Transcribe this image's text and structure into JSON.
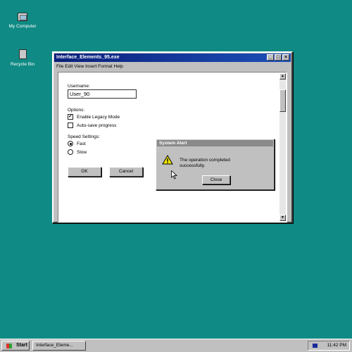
{
  "desktop": {
    "icons": [
      {
        "label": "My Computer",
        "icon": "computer-icon"
      },
      {
        "label": "Recycle Bin",
        "icon": "recycle-bin-icon"
      }
    ],
    "background_color": "#0f8a84"
  },
  "window": {
    "title": "Interface_Elements_95.exe",
    "controls": {
      "minimize": "_",
      "maximize": "□",
      "close": "×"
    },
    "menu": "File Edit View Insert Format Help",
    "form": {
      "username_label": "Username:",
      "username_value": "User_90",
      "options_label": "Options:",
      "options": [
        {
          "label": "Enable Legacy Mode",
          "checked": true,
          "mark": "✓"
        },
        {
          "label": "Auto-save progress",
          "checked": false,
          "mark": ""
        }
      ],
      "speed_label": "Speed Settings:",
      "speeds": [
        {
          "label": "Fast",
          "selected": true
        },
        {
          "label": "Slow",
          "selected": false
        }
      ],
      "ok_label": "OK",
      "cancel_label": "Cancel"
    },
    "scroll": {
      "up": "▲",
      "down": "▼"
    }
  },
  "alert": {
    "title": "System Alert",
    "icon": "warning-icon",
    "message": "The operation completed successfully.",
    "close_label": "Close"
  },
  "taskbar": {
    "start_label": "Start",
    "task_label": "Interface_Eleme...",
    "clock": "11:42 PM"
  },
  "colors": {
    "title_active": "#0a1f7a",
    "title_inactive": "#8a8a8a",
    "face": "#c0c0c0"
  }
}
